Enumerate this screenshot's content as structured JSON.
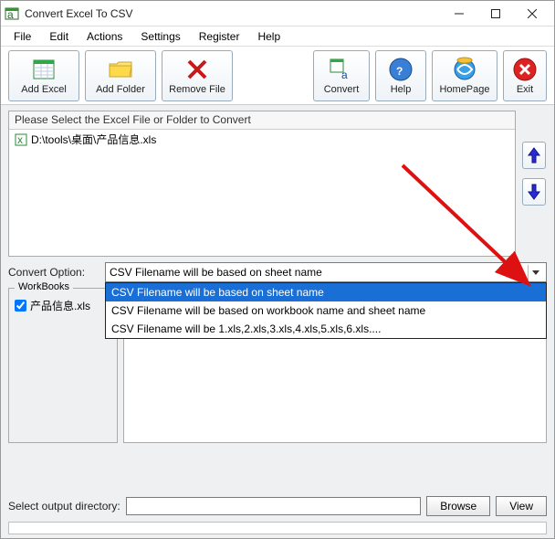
{
  "titlebar": {
    "title": "Convert Excel To CSV"
  },
  "menu": {
    "file": "File",
    "edit": "Edit",
    "actions": "Actions",
    "settings": "Settings",
    "register": "Register",
    "help": "Help"
  },
  "toolbar": {
    "add_excel": "Add Excel",
    "add_folder": "Add Folder",
    "remove_file": "Remove File",
    "convert": "Convert",
    "help": "Help",
    "homepage": "HomePage",
    "exit": "Exit"
  },
  "fileList": {
    "header": "Please Select the Excel File or Folder to Convert",
    "items": [
      "D:\\tools\\桌面\\产品信息.xls"
    ]
  },
  "convertOption": {
    "label": "Convert Option:",
    "selected": "CSV Filename will be based on sheet name",
    "options": [
      "CSV Filename will be based on sheet name",
      "CSV Filename will be based on workbook name and sheet name",
      "CSV Filename will be 1.xls,2.xls,3.xls,4.xls,5.xls,6.xls...."
    ]
  },
  "workbooks": {
    "title": "WorkBooks",
    "items": [
      {
        "checked": true,
        "label": "产品信息.xls"
      }
    ]
  },
  "output": {
    "label": "Select  output directory:",
    "path": "",
    "browse": "Browse",
    "view": "View"
  }
}
